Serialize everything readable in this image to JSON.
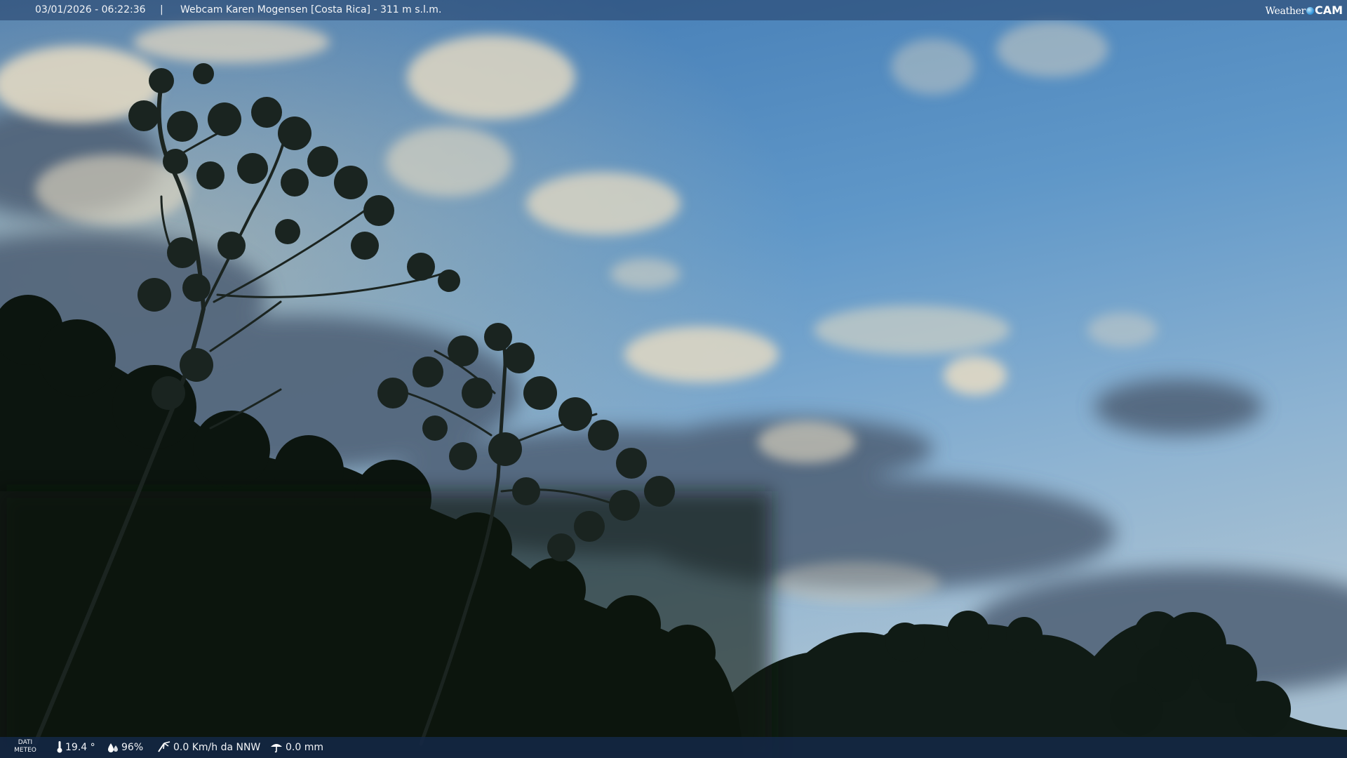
{
  "header": {
    "datetime": "03/01/2026 - 06:22:36",
    "separator": "|",
    "caption": "Webcam Karen Mogensen [Costa Rica]  -  311 m s.l.m."
  },
  "brand": {
    "word1": "Weather",
    "word2": "CAM"
  },
  "footer": {
    "label_line1": "DATI",
    "label_line2": "METEO",
    "temperature": "19.4 °",
    "humidity": "96%",
    "wind": "0.0 Km/h da NNW",
    "rain": "0.0 mm",
    "icons": [
      "thermometer-icon",
      "humidity-drops-icon",
      "wind-icon",
      "rain-icon"
    ]
  },
  "colors": {
    "sky_top": "#4f86bd",
    "sky_mid": "#6b9fcc",
    "sky_bottom": "#a9c6d9",
    "cloud_light": "#e6dcc8",
    "cloud_dark": "#5c6f86",
    "foliage": "#0d1611"
  }
}
